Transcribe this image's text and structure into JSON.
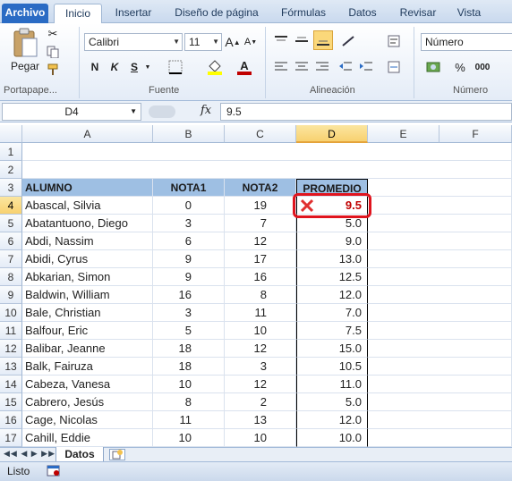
{
  "ribbon_tabs": [
    "Archivo",
    "Inicio",
    "Insertar",
    "Diseño de página",
    "Fórmulas",
    "Datos",
    "Revisar",
    "Vista"
  ],
  "clipboard": {
    "paste_label": "Pegar",
    "group_label": "Portapape..."
  },
  "font": {
    "name": "Calibri",
    "size": "11",
    "bold": "N",
    "italic": "K",
    "underline": "S",
    "grow": "A",
    "shrink": "A",
    "group_label": "Fuente",
    "font_color": "#c00000",
    "fill_color": "#ffff00"
  },
  "alignment": {
    "group_label": "Alineación"
  },
  "number": {
    "format": "Número",
    "group_label": "Número",
    "percent": "%"
  },
  "formula_bar": {
    "name_box": "D4",
    "fx": "fx",
    "value": "9.5"
  },
  "columns": [
    "A",
    "B",
    "C",
    "D",
    "E",
    "F"
  ],
  "selected_column": "D",
  "selected_row": "4",
  "headers": {
    "alumno": "ALUMNO",
    "nota1": "NOTA1",
    "nota2": "NOTA2",
    "promedio": "PROMEDIO"
  },
  "rows": [
    {
      "row": "1",
      "alumno": "",
      "nota1": "",
      "nota2": "",
      "promedio": ""
    },
    {
      "row": "2",
      "alumno": "",
      "nota1": "",
      "nota2": "",
      "promedio": ""
    },
    {
      "row": "4",
      "alumno": "Abascal, Silvia",
      "nota1": "0",
      "nota2": "19",
      "promedio": "9.5"
    },
    {
      "row": "5",
      "alumno": "Abatantuono, Diego",
      "nota1": "3",
      "nota2": "7",
      "promedio": "5.0"
    },
    {
      "row": "6",
      "alumno": "Abdi, Nassim",
      "nota1": "6",
      "nota2": "12",
      "promedio": "9.0"
    },
    {
      "row": "7",
      "alumno": "Abidi, Cyrus",
      "nota1": "9",
      "nota2": "17",
      "promedio": "13.0"
    },
    {
      "row": "8",
      "alumno": "Abkarian, Simon",
      "nota1": "9",
      "nota2": "16",
      "promedio": "12.5"
    },
    {
      "row": "9",
      "alumno": "Baldwin, William",
      "nota1": "16",
      "nota2": "8",
      "promedio": "12.0"
    },
    {
      "row": "10",
      "alumno": "Bale, Christian",
      "nota1": "3",
      "nota2": "11",
      "promedio": "7.0"
    },
    {
      "row": "11",
      "alumno": "Balfour, Eric",
      "nota1": "5",
      "nota2": "10",
      "promedio": "7.5"
    },
    {
      "row": "12",
      "alumno": "Balibar, Jeanne",
      "nota1": "18",
      "nota2": "12",
      "promedio": "15.0"
    },
    {
      "row": "13",
      "alumno": "Balk, Fairuza",
      "nota1": "18",
      "nota2": "3",
      "promedio": "10.5"
    },
    {
      "row": "14",
      "alumno": "Cabeza, Vanesa",
      "nota1": "10",
      "nota2": "12",
      "promedio": "11.0"
    },
    {
      "row": "15",
      "alumno": "Cabrero, Jesús",
      "nota1": "8",
      "nota2": "2",
      "promedio": "5.0"
    },
    {
      "row": "16",
      "alumno": "Cage, Nicolas",
      "nota1": "11",
      "nota2": "13",
      "promedio": "12.0"
    },
    {
      "row": "17",
      "alumno": "Cahill, Eddie",
      "nota1": "10",
      "nota2": "10",
      "promedio": "10.0"
    }
  ],
  "header_row": "3",
  "sheet_tab": "Datos",
  "status": "Listo",
  "colors": {
    "header_fill": "#9ebfe3",
    "error_red": "#c00000",
    "highlight_red": "#e0141e"
  }
}
